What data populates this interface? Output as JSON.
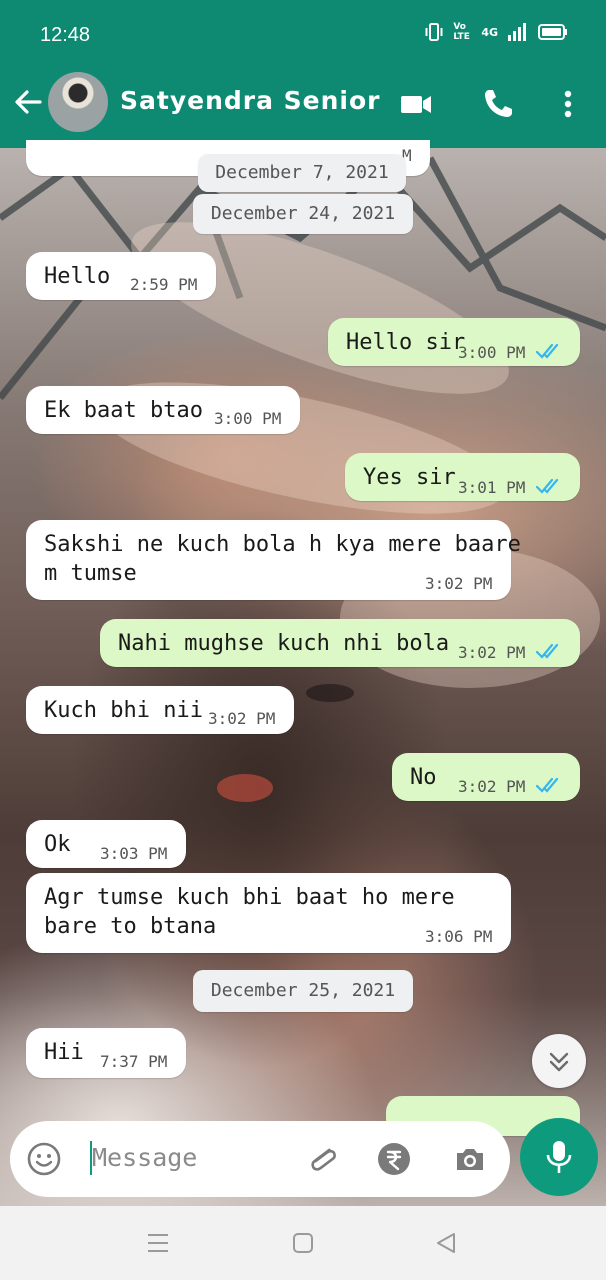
{
  "status_bar": {
    "time": "12:48",
    "network": "4G",
    "volte": "Vo LTE"
  },
  "header": {
    "contact_name": "Satyendra Senior"
  },
  "date_chips": [
    "December 7, 2021",
    "December 24, 2021",
    "December 25, 2021"
  ],
  "partial_top_time": "M",
  "messages": [
    {
      "dir": "in",
      "lines": [
        "Hello"
      ],
      "time": "2:59 PM"
    },
    {
      "dir": "out",
      "lines": [
        "Hello sir"
      ],
      "time": "3:00 PM"
    },
    {
      "dir": "in",
      "lines": [
        "Ek baat btao"
      ],
      "time": "3:00 PM"
    },
    {
      "dir": "out",
      "lines": [
        "Yes sir"
      ],
      "time": "3:01 PM"
    },
    {
      "dir": "in",
      "lines": [
        "Sakshi ne kuch bola h kya mere baare",
        "m tumse"
      ],
      "time": "3:02 PM"
    },
    {
      "dir": "out",
      "lines": [
        "Nahi mughse kuch nhi bola"
      ],
      "time": "3:02 PM"
    },
    {
      "dir": "in",
      "lines": [
        "Kuch bhi nii"
      ],
      "time": "3:02 PM"
    },
    {
      "dir": "out",
      "lines": [
        "No"
      ],
      "time": "3:02 PM"
    },
    {
      "dir": "in",
      "lines": [
        "Ok"
      ],
      "time": "3:03 PM"
    },
    {
      "dir": "in",
      "lines": [
        "Agr tumse kuch bhi baat ho mere",
        "bare to btana"
      ],
      "time": "3:06 PM"
    },
    {
      "dir": "in",
      "lines": [
        "Hii"
      ],
      "time": "7:37 PM"
    }
  ],
  "input": {
    "placeholder": "Message"
  },
  "colors": {
    "brand": "#0e8a73",
    "outgoing": "#dcf8c6",
    "read_tick": "#34b7f1",
    "mic": "#0e9a7d"
  },
  "icons": [
    "back-arrow-icon",
    "video-call-icon",
    "phone-icon",
    "more-vert-icon",
    "emoji-icon",
    "attach-icon",
    "rupee-icon",
    "camera-icon",
    "mic-icon",
    "scroll-down-icon",
    "nav-menu-icon",
    "nav-home-icon",
    "nav-back-icon"
  ]
}
